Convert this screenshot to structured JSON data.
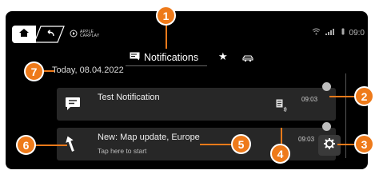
{
  "status_bar": {
    "carplay_label": "APPLE CARPLAY",
    "time": "09:0"
  },
  "tabs": {
    "notifications_label": "Notifications"
  },
  "date_label": "Today, 08.04.2022",
  "notifications": [
    {
      "title": "Test Notification",
      "time": "09:03",
      "icon": "message-icon"
    },
    {
      "title": "New: Map update, Europe",
      "subtitle": "Tap here to start",
      "time": "09:03",
      "icon": "navigation-arrow-icon"
    }
  ],
  "callouts": [
    "1",
    "2",
    "3",
    "4",
    "5",
    "6",
    "7"
  ],
  "colors": {
    "callout": "#ee7a1a",
    "screen_bg": "#000000",
    "card_bg": "#272727"
  }
}
